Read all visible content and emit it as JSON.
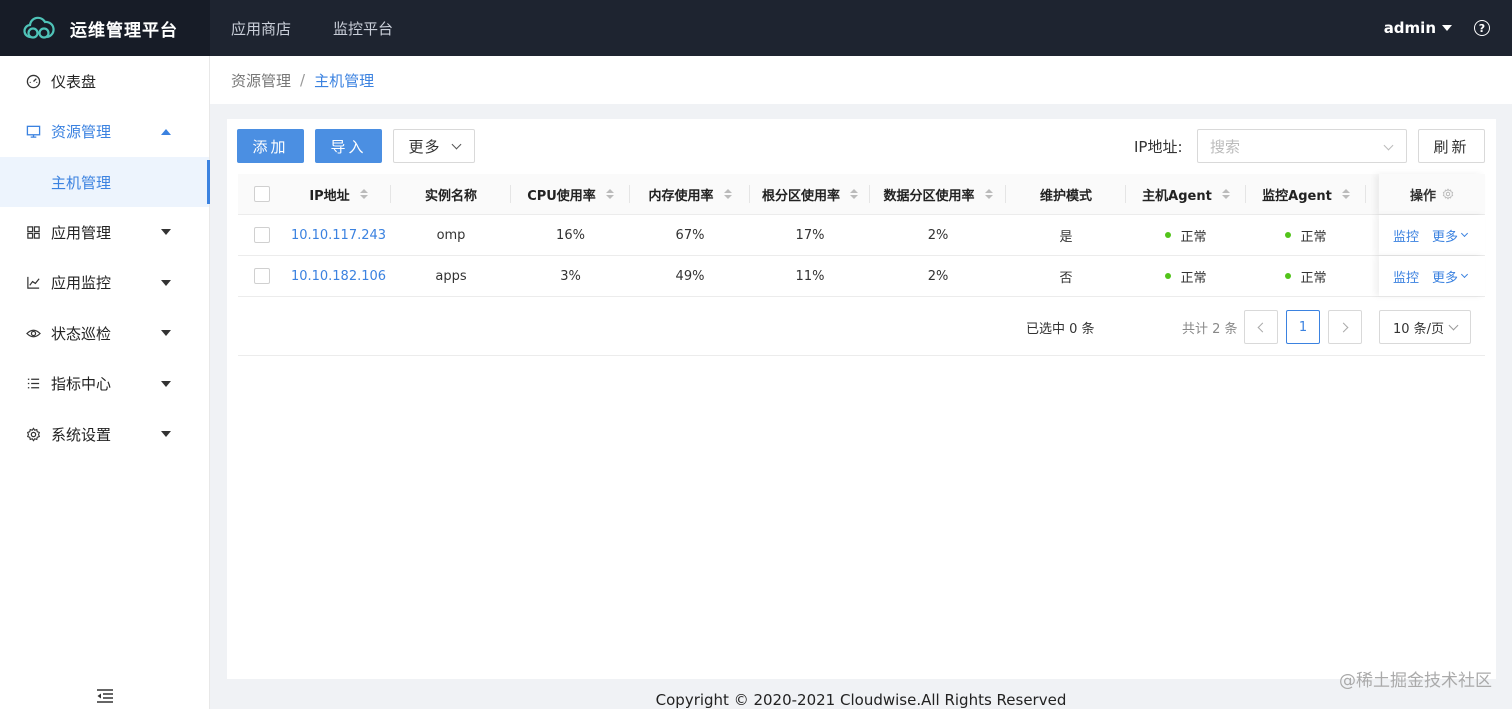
{
  "app": {
    "title": "运维管理平台"
  },
  "topnav": [
    "应用商店",
    "监控平台"
  ],
  "user": {
    "name": "admin",
    "help": "?"
  },
  "sidebar": {
    "items": [
      {
        "label": "仪表盘",
        "icon": "dashboard-icon"
      },
      {
        "label": "资源管理",
        "icon": "monitor-icon",
        "open": true,
        "children": [
          {
            "label": "主机管理",
            "active": true
          }
        ]
      },
      {
        "label": "应用管理",
        "icon": "apps-icon"
      },
      {
        "label": "应用监控",
        "icon": "chart-icon"
      },
      {
        "label": "状态巡检",
        "icon": "eye-icon"
      },
      {
        "label": "指标中心",
        "icon": "list-icon"
      },
      {
        "label": "系统设置",
        "icon": "gear-icon"
      }
    ]
  },
  "breadcrumb": {
    "parent": "资源管理",
    "sep": "/",
    "current": "主机管理"
  },
  "toolbar": {
    "add_label": "添加",
    "import_label": "导入",
    "more_label": "更多",
    "ip_label": "IP地址:",
    "search_placeholder": "搜索",
    "refresh_label": "刷新"
  },
  "table": {
    "columns": [
      "IP地址",
      "实例名称",
      "CPU使用率",
      "内存使用率",
      "根分区使用率",
      "数据分区使用率",
      "维护模式",
      "主机Agent",
      "监控Agent",
      "操作"
    ],
    "rows": [
      {
        "ip": "10.10.117.243",
        "name": "omp",
        "cpu": "16%",
        "mem": "67%",
        "root": "17%",
        "data": "2%",
        "maint": "是",
        "host_agent": "正常",
        "mon_agent": "正常",
        "op_monitor": "监控",
        "op_more": "更多"
      },
      {
        "ip": "10.10.182.106",
        "name": "apps",
        "cpu": "3%",
        "mem": "49%",
        "root": "11%",
        "data": "2%",
        "maint": "否",
        "host_agent": "正常",
        "mon_agent": "正常",
        "op_monitor": "监控",
        "op_more": "更多"
      }
    ]
  },
  "pagination": {
    "selected": "已选中 0 条",
    "total": "共计 2 条",
    "current_page": "1",
    "page_size": "10 条/页"
  },
  "footer": {
    "copyright": "Copyright © 2020-2021 Cloudwise.All Rights Reserved"
  },
  "watermark": "@稀土掘金技术社区",
  "colors": {
    "header_bg": "#1e2430",
    "accent": "#3b82e0",
    "primary_btn": "#4b8fe2",
    "status_ok": "#52c41a"
  }
}
